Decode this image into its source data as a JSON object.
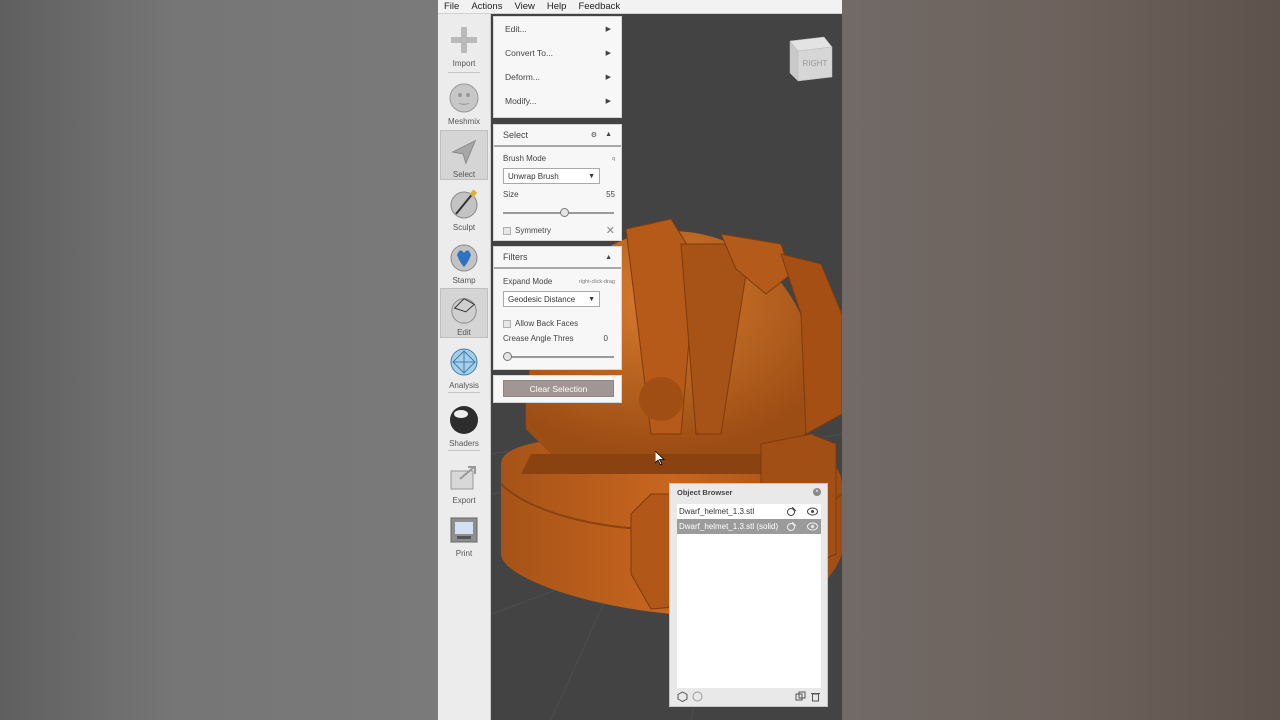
{
  "menubar": {
    "items": [
      "File",
      "Actions",
      "View",
      "Help",
      "Feedback"
    ]
  },
  "toolbar": {
    "tools": [
      {
        "label": "Import",
        "icon": "plus-icon"
      },
      {
        "label": "Meshmix",
        "icon": "meshmix-sphere-icon"
      },
      {
        "label": "Select",
        "icon": "arrow-select-icon",
        "active": true
      },
      {
        "label": "Sculpt",
        "icon": "brush-sphere-icon"
      },
      {
        "label": "Stamp",
        "icon": "stamp-sphere-icon"
      },
      {
        "label": "Edit",
        "icon": "edit-sphere-icon",
        "active": true
      },
      {
        "label": "Analysis",
        "icon": "analysis-sphere-icon"
      },
      {
        "label": "Shaders",
        "icon": "shader-sphere-icon"
      },
      {
        "label": "Export",
        "icon": "export-icon"
      },
      {
        "label": "Print",
        "icon": "printer-icon"
      }
    ]
  },
  "edit_menu": {
    "items": [
      "Edit...",
      "Convert To...",
      "Deform...",
      "Modify..."
    ]
  },
  "select_panel": {
    "title": "Select",
    "brush_mode_label": "Brush Mode",
    "brush_mode_hotkey": "q",
    "brush_mode_value": "Unwrap Brush",
    "size_label": "Size",
    "size_value": "55",
    "size_fraction": 0.55,
    "symmetry_label": "Symmetry"
  },
  "filters_panel": {
    "title": "Filters",
    "expand_mode_label": "Expand Mode",
    "expand_mode_hint": "right-click-drag",
    "expand_mode_value": "Geodesic Distance",
    "allow_back_faces_label": "Allow Back Faces",
    "crease_label": "Crease Angle Thres",
    "crease_value": "0"
  },
  "clear_selection_label": "Clear Selection",
  "viewcube": {
    "face_label": "RIGHT"
  },
  "object_browser": {
    "title": "Object Browser",
    "objects": [
      {
        "name": "Dwarf_helmet_1.3.stl",
        "selected": false
      },
      {
        "name": "Dwarf_helmet_1.3.stl (solid)",
        "selected": true
      }
    ]
  },
  "colors": {
    "model": "#c0621a",
    "viewport": "#434343",
    "button": "#a19693"
  }
}
